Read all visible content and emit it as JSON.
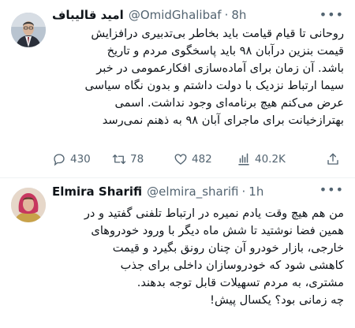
{
  "tweets": [
    {
      "name": "امید قالیباف",
      "handle": "@OmidGhalibaf",
      "time": "8h",
      "lines": [
        "روحانی تا قیام قیامت باید بخاطر بی‌تدبیری درافزایش",
        "قیمت بنزین درآبان ۹۸ باید پاسخگوی مردم و تاریخ",
        "باشد. آن زمان برای آماده‌سازی افکارعمومی در خبر",
        "سیما ارتباط نزدیک با دولت داشتم و بدون نگاه سیاسی",
        "عرض می‌کنم هیچ برنامه‌ای وجود نداشت. اسمی",
        "بهترازخیانت برای ماجرای آبان ۹۸ به ذهنم نمی‌رسد"
      ],
      "stats": {
        "replies": "430",
        "retweets": "78",
        "likes": "482",
        "views": "40.2K"
      }
    },
    {
      "name": "Elmira Sharifi",
      "handle": "@elmira_sharifi",
      "time": "1h",
      "lines": [
        "من هم هیچ وقت یادم نمیره در ارتباط تلفنی گفتید و در",
        "همین فضا نوشتید تا شش ماه دیگر با ورود خودروهای",
        "خارجی، بازار خودرو آن چنان رونق بگیرد و قیمت",
        "کاهشی شود که خودروسازان داخلی برای جذب",
        "مشتری، به مردم تسهیلات قابل توجه بدهند.",
        "چه زمانی بود؟ یکسال پیش!"
      ]
    }
  ],
  "icons": [
    "reply-icon",
    "retweet-icon",
    "like-icon",
    "views-icon",
    "share-icon",
    "more-icon"
  ],
  "colors": {
    "text": "#0f1419",
    "secondary": "#536471",
    "divider": "#eff3f4"
  }
}
